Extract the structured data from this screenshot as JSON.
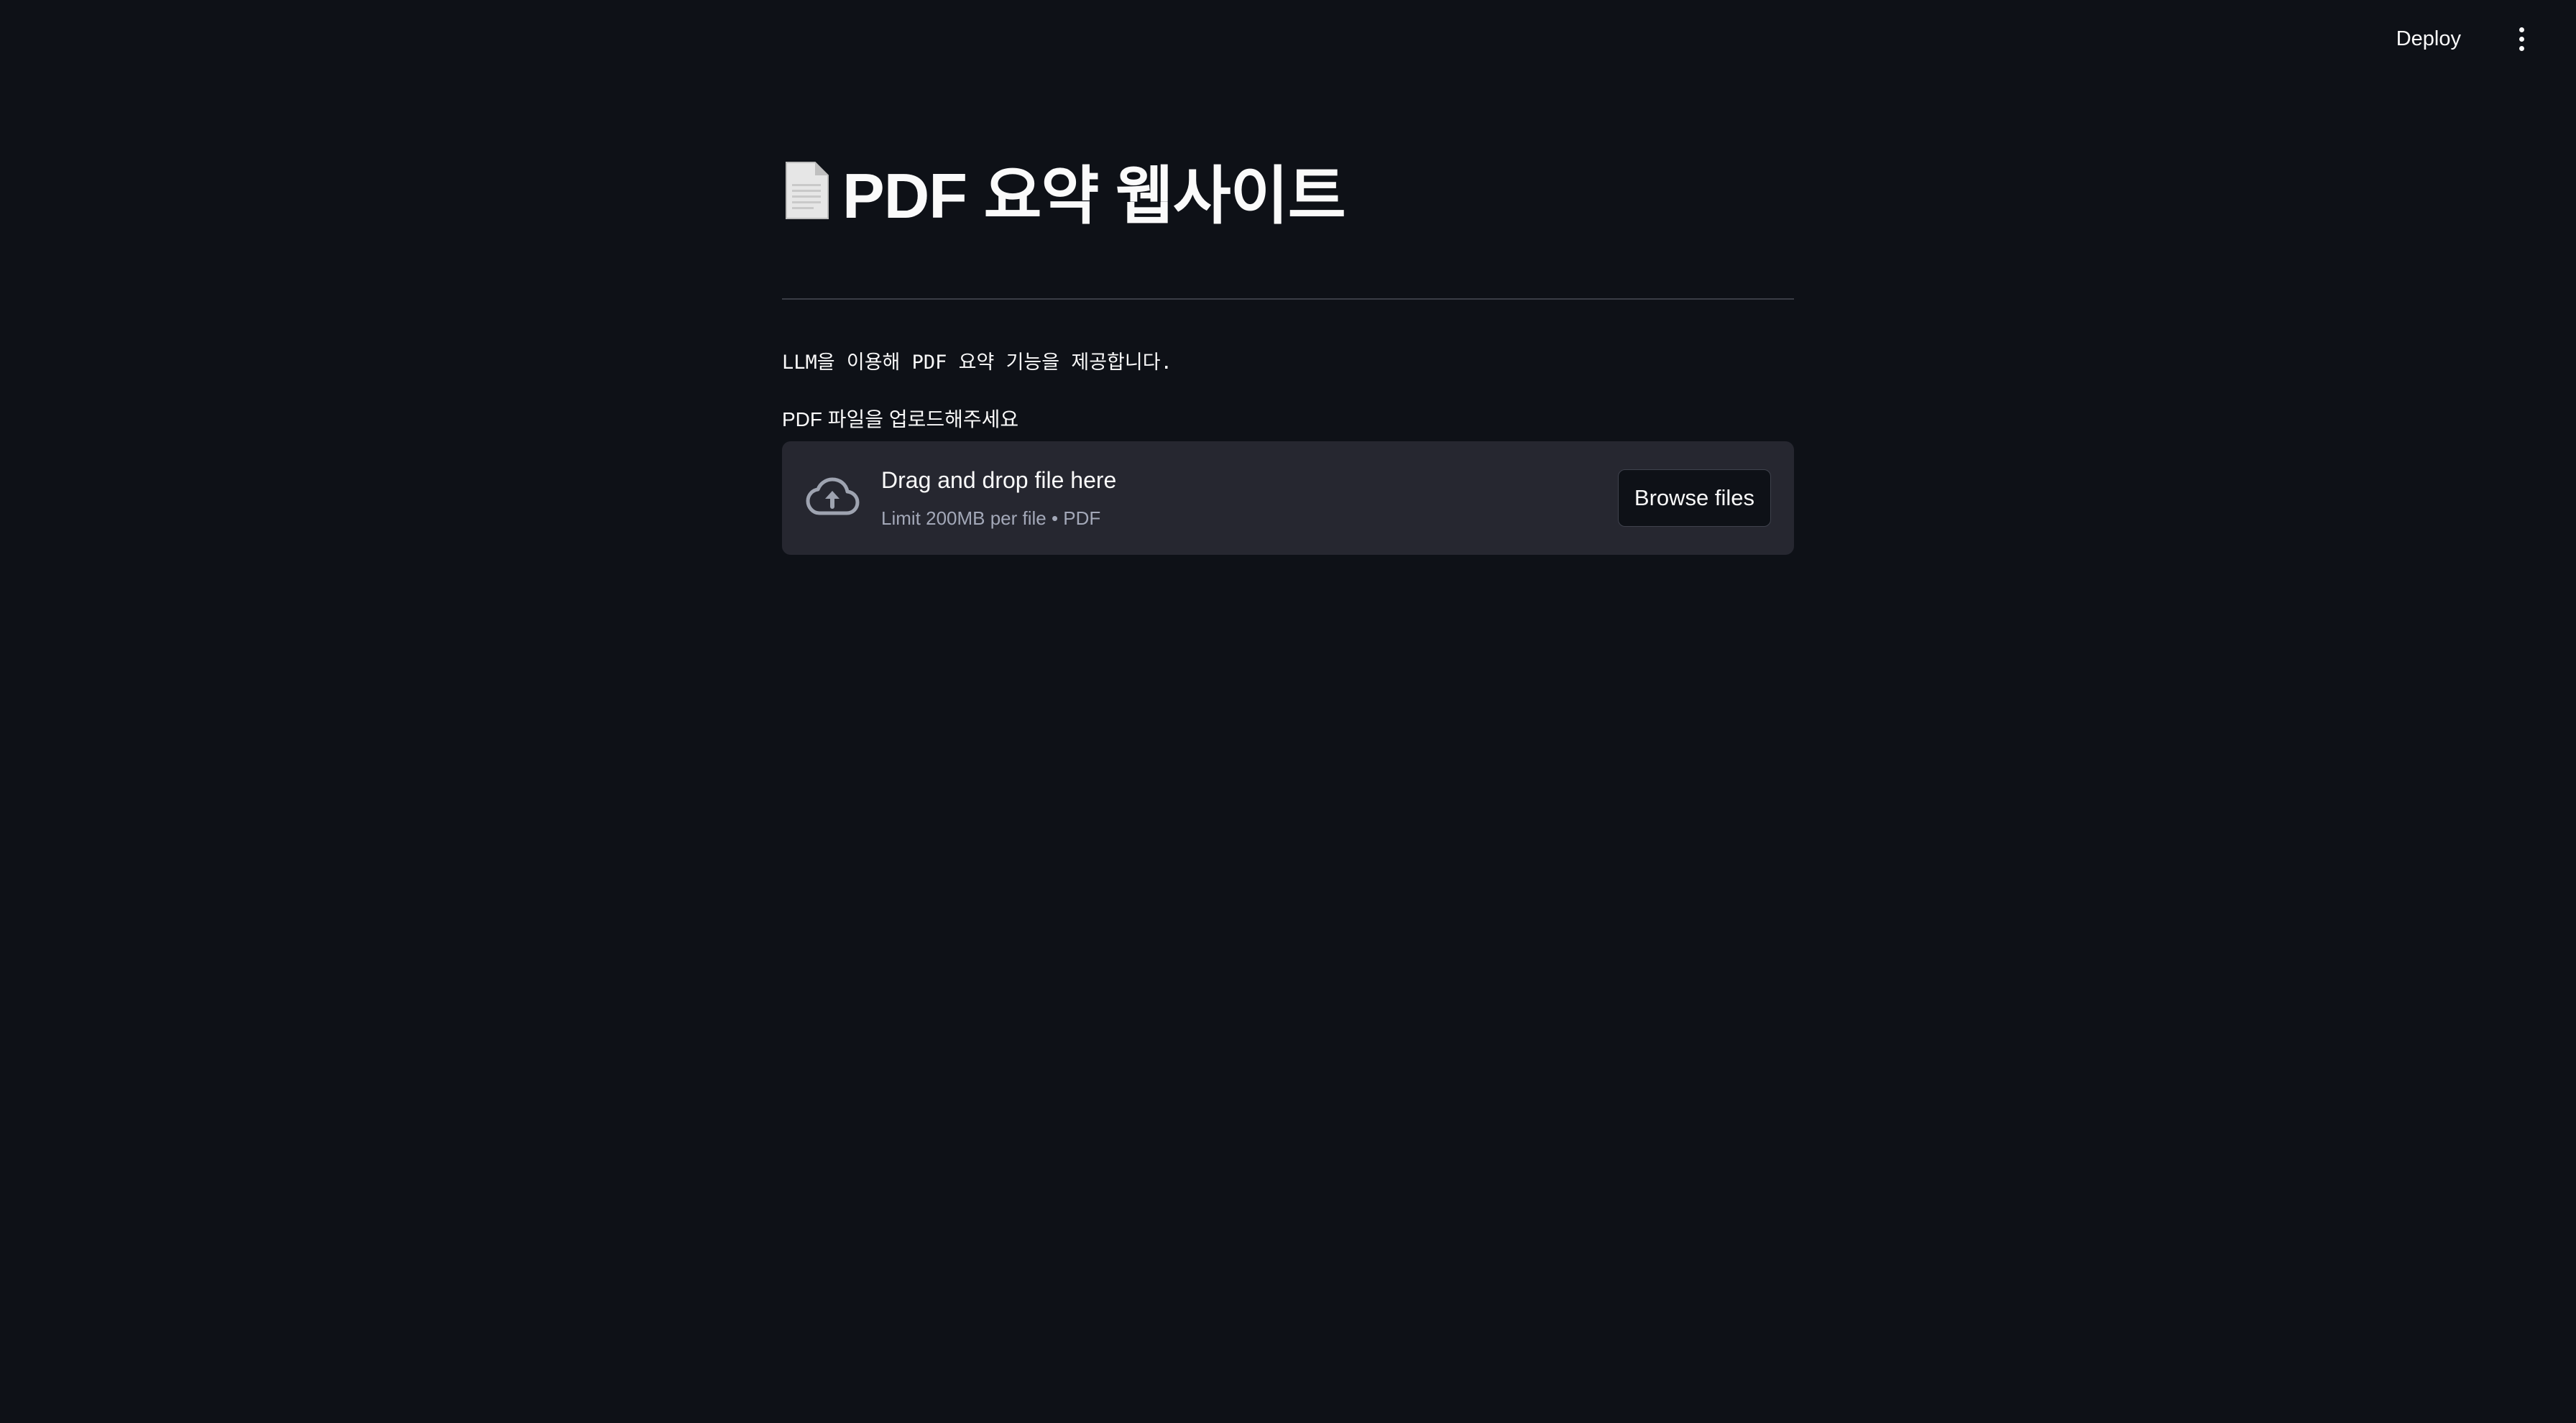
{
  "header": {
    "deploy_label": "Deploy",
    "menu_icon": "kebab-menu-icon"
  },
  "main": {
    "title_icon": "page-facing-up-icon",
    "title": "PDF 요약 웹사이트",
    "description": "LLM을 이용해 PDF 요약 기능을 제공합니다.",
    "uploader": {
      "label": "PDF 파일을 업로드해주세요",
      "drop_title": "Drag and drop file here",
      "drop_subtitle": "Limit 200MB per file • PDF",
      "browse_label": "Browse files",
      "icon": "cloud-upload-icon"
    }
  },
  "colors": {
    "background": "#0e1117",
    "surface": "#262730",
    "text": "#fafafa",
    "muted_text": "#a3a8b8",
    "divider": "#3a3d46"
  }
}
